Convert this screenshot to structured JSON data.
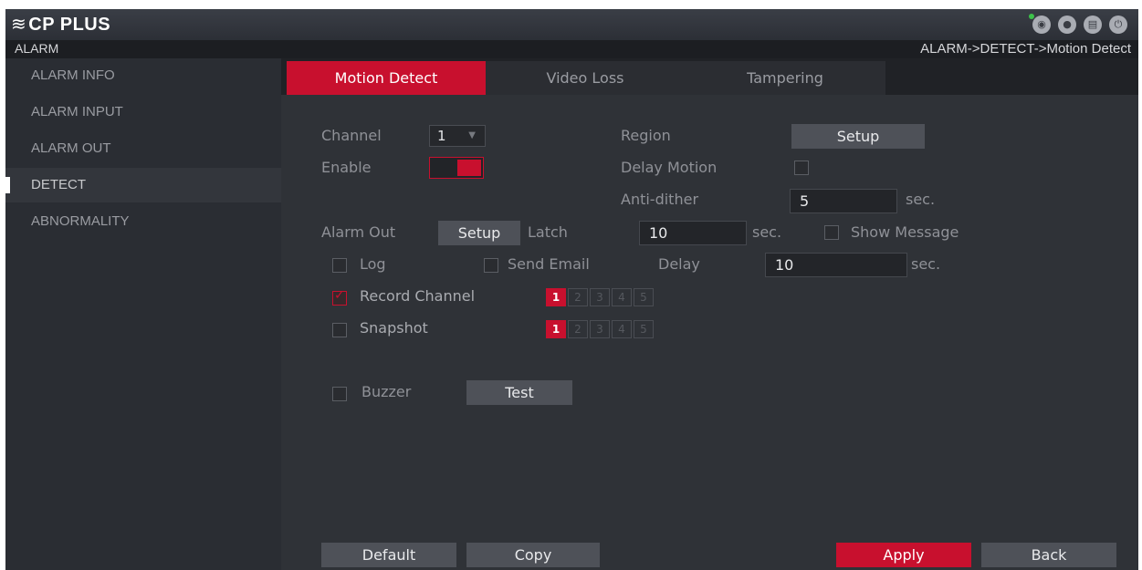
{
  "app": {
    "logo_mark": "≋",
    "logo_text": "CP PLUS"
  },
  "top_icons": [
    "eye-icon",
    "user-icon",
    "network-icon",
    "power-icon"
  ],
  "header": {
    "section": "ALARM",
    "breadcrumb": "ALARM->DETECT->Motion Detect"
  },
  "sidebar": {
    "items": [
      {
        "label": "ALARM INFO",
        "active": false
      },
      {
        "label": "ALARM INPUT",
        "active": false
      },
      {
        "label": "ALARM OUT",
        "active": false
      },
      {
        "label": "DETECT",
        "active": true
      },
      {
        "label": "ABNORMALITY",
        "active": false
      }
    ]
  },
  "tabs": [
    {
      "label": "Motion Detect",
      "active": true
    },
    {
      "label": "Video Loss",
      "active": false
    },
    {
      "label": "Tampering",
      "active": false
    }
  ],
  "form": {
    "channel_label": "Channel",
    "channel_value": "1",
    "dropdown_arrow": "▼",
    "enable_label": "Enable",
    "enable_on": true,
    "region_label": "Region",
    "region_button": "Setup",
    "delay_motion_label": "Delay Motion",
    "delay_motion_checked": false,
    "anti_dither_label": "Anti-dither",
    "anti_dither_value": "5",
    "anti_dither_unit": "sec.",
    "alarm_out_label": "Alarm Out",
    "alarm_out_button": "Setup",
    "latch_label": "Latch",
    "latch_value": "10",
    "latch_unit": "sec.",
    "show_message_label": "Show Message",
    "show_message_checked": false,
    "log_label": "Log",
    "log_checked": false,
    "send_email_label": "Send Email",
    "send_email_checked": false,
    "delay_label": "Delay",
    "delay_value": "10",
    "delay_unit": "sec.",
    "record_channel_label": "Record Channel",
    "record_channel_checked": true,
    "record_channels": [
      {
        "num": "1",
        "on": true
      },
      {
        "num": "2",
        "on": false
      },
      {
        "num": "3",
        "on": false
      },
      {
        "num": "4",
        "on": false
      },
      {
        "num": "5",
        "on": false
      }
    ],
    "snapshot_label": "Snapshot",
    "snapshot_checked": false,
    "snapshot_channels": [
      {
        "num": "1",
        "on": true
      },
      {
        "num": "2",
        "on": false
      },
      {
        "num": "3",
        "on": false
      },
      {
        "num": "4",
        "on": false
      },
      {
        "num": "5",
        "on": false
      }
    ],
    "buzzer_label": "Buzzer",
    "buzzer_checked": false,
    "test_button": "Test"
  },
  "footer": {
    "default": "Default",
    "copy": "Copy",
    "apply": "Apply",
    "back": "Back"
  },
  "colors": {
    "accent": "#c8102e",
    "background": "#2f3237",
    "sidebar": "#2a2d33"
  }
}
